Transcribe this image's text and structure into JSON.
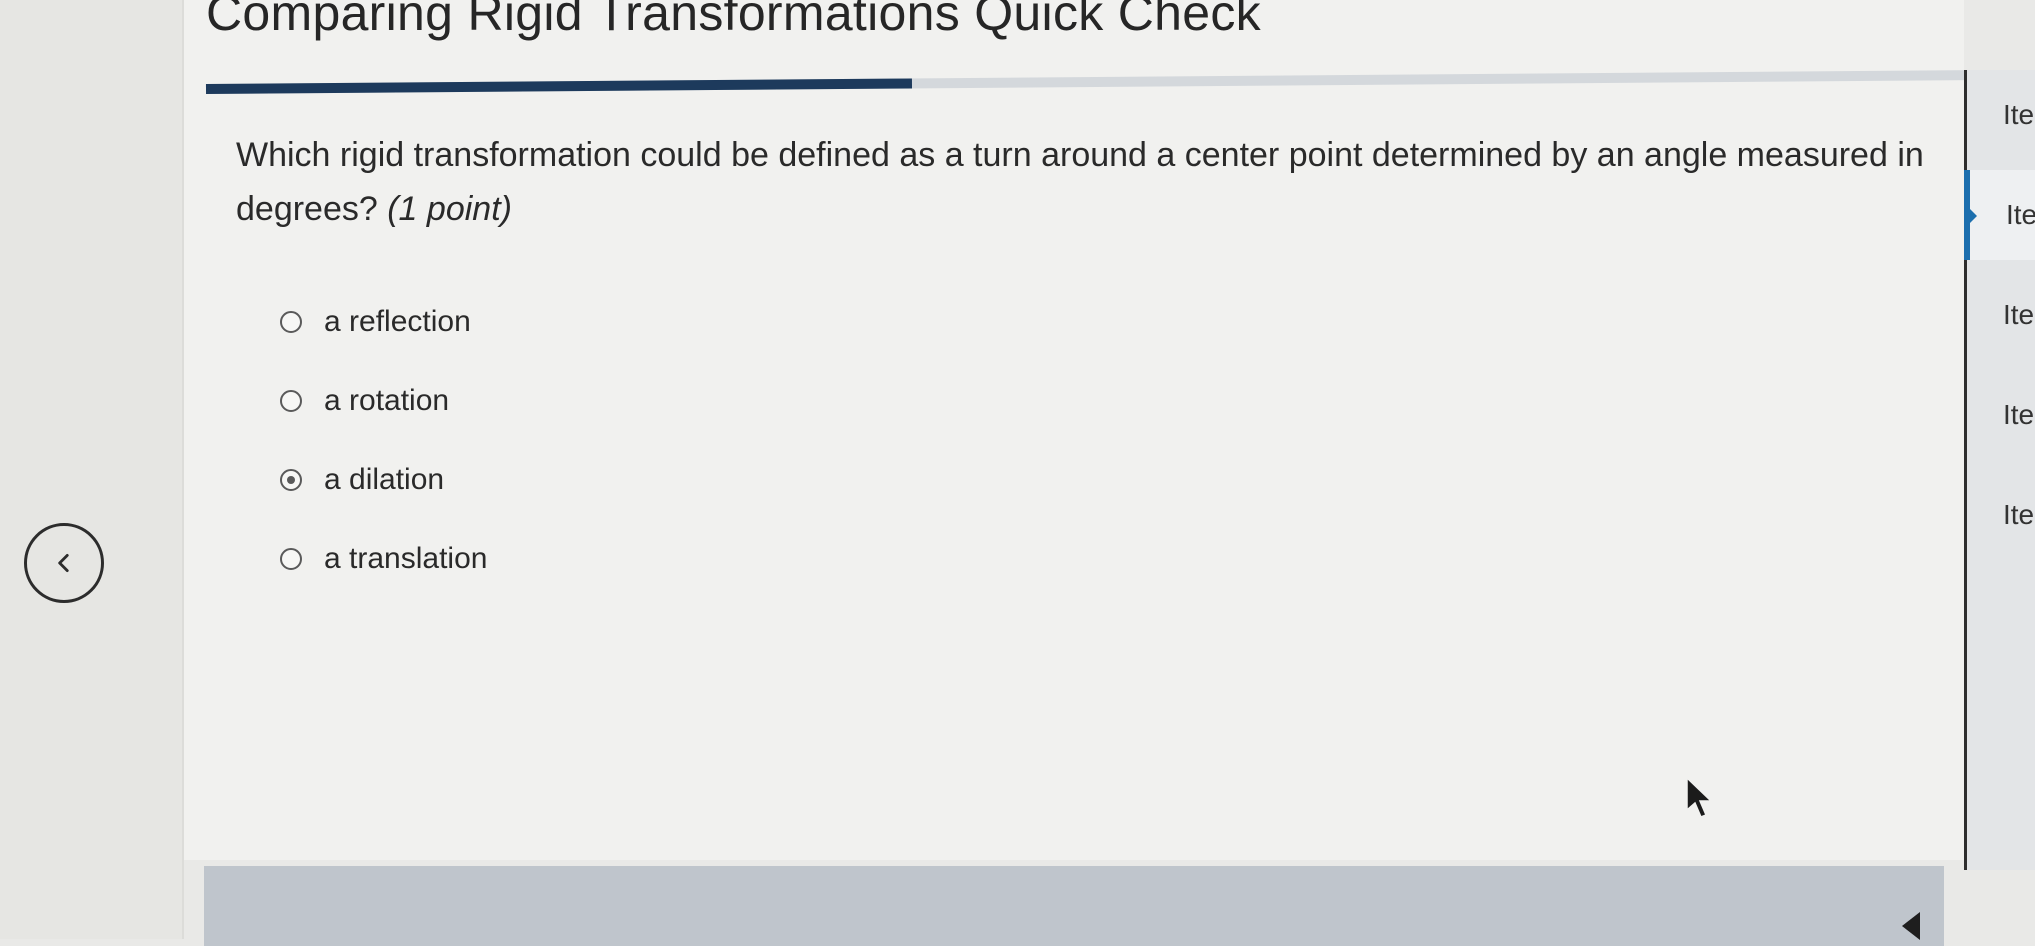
{
  "page": {
    "title": "Comparing Rigid Transformations Quick Check"
  },
  "progress": {
    "fraction": 0.4
  },
  "question": {
    "text": "Which rigid transformation could be defined as a turn around a center point determined by an angle measured in degrees?",
    "points": "(1 point)"
  },
  "options": [
    {
      "label": "a reflection",
      "selected": false
    },
    {
      "label": "a rotation",
      "selected": false
    },
    {
      "label": "a dilation",
      "selected": true
    },
    {
      "label": "a translation",
      "selected": false
    }
  ],
  "sidebar": {
    "items": [
      {
        "label": "Ite",
        "current": false
      },
      {
        "label": "Ite",
        "current": true
      },
      {
        "label": "Ite",
        "current": false
      },
      {
        "label": "Ite",
        "current": false
      },
      {
        "label": "Ite",
        "current": false
      }
    ]
  },
  "icons": {
    "back": "chevron-left-icon",
    "footer": "arrow-left-icon",
    "cursor": "mouse-pointer-icon"
  },
  "colors": {
    "progress_fill": "#1d3a5c",
    "current_item_accent": "#1c6fae"
  }
}
